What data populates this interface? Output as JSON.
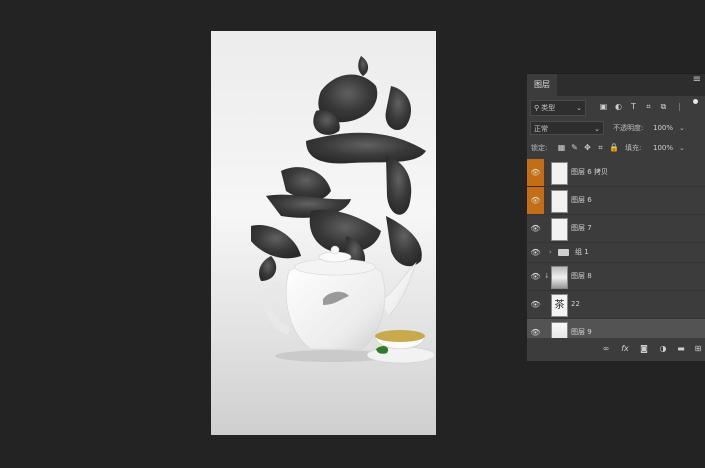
{
  "canvas": {
    "title": "poster-canvas",
    "calligraphy_char": "茶"
  },
  "layers_panel": {
    "tab_label": "图层",
    "menu_icon": "≡",
    "filter": {
      "kind_label": "类型",
      "search_icon": "search-icon",
      "dropdown_icon": "⌄"
    },
    "blend_mode": "正常",
    "opacity_label": "不透明度:",
    "opacity_value": "100%",
    "lock_label": "锁定:",
    "fill_label": "填充:",
    "fill_value": "100%",
    "layers": [
      {
        "name": "图层 6 拷贝",
        "visible": true,
        "selected": true
      },
      {
        "name": "图层 6",
        "visible": true,
        "selected": true
      },
      {
        "name": "图层 7",
        "visible": true,
        "selected": false
      },
      {
        "name": "组 1",
        "visible": true,
        "group": true
      },
      {
        "name": "图层 8",
        "visible": true,
        "linked": true
      },
      {
        "name": "22",
        "visible": true
      },
      {
        "name": "图层 9",
        "visible": true,
        "active": true
      }
    ],
    "bottom_icons": [
      "link-icon",
      "fx-icon",
      "mask-icon",
      "adjustment-icon",
      "folder-icon",
      "new-layer-icon"
    ],
    "fx_label": "fx",
    "accent_color": "#c46d12"
  }
}
